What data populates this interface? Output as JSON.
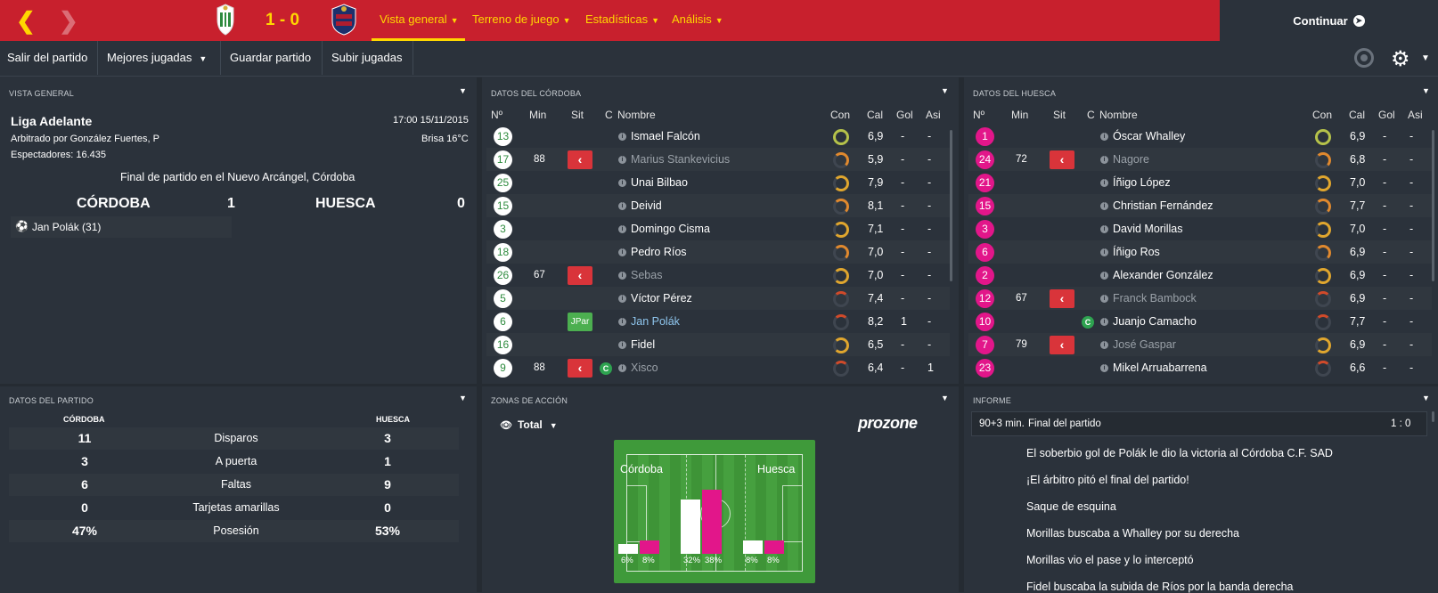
{
  "top": {
    "score": "1 - 0",
    "tabs": [
      {
        "label": "Vista general"
      },
      {
        "label": "Terreno de juego"
      },
      {
        "label": "Estadísticas"
      },
      {
        "label": "Análisis"
      }
    ],
    "continue_label": "Continuar"
  },
  "subbar": {
    "buttons": [
      "Salir del partido",
      "Mejores jugadas",
      "Guardar partido",
      "Subir jugadas"
    ]
  },
  "overview": {
    "title": "VISTA GENERAL",
    "league": "Liga Adelante",
    "datetime": "17:00 15/11/2015",
    "referee": "Arbitrado por González Fuertes, P",
    "weather": "Brisa 16°C",
    "attendance": "Espectadores: 16.435",
    "final": "Final de partido en el Nuevo Arcángel, Córdoba",
    "home": "CÓRDOBA",
    "home_goals": "1",
    "away": "HUESCA",
    "away_goals": "0",
    "scorer": "Jan Polák (31)"
  },
  "cordoba": {
    "title": "DATOS DEL CÓRDOBA",
    "headers": {
      "num": "Nº",
      "min": "Min",
      "sit": "Sit",
      "c": "C",
      "name": "Nombre",
      "con": "Con",
      "cal": "Cal",
      "gol": "Gol",
      "asi": "Asi"
    },
    "rows": [
      {
        "num": "13",
        "min": "",
        "name": "Ismael Falcón",
        "cal": "6,9",
        "gol": "-",
        "asi": "-"
      },
      {
        "num": "17",
        "min": "88",
        "name": "Marius Stankevicius",
        "cal": "5,9",
        "gol": "-",
        "asi": "-"
      },
      {
        "num": "25",
        "min": "",
        "name": "Unai Bilbao",
        "cal": "7,9",
        "gol": "-",
        "asi": "-"
      },
      {
        "num": "15",
        "min": "",
        "name": "Deivid",
        "cal": "8,1",
        "gol": "-",
        "asi": "-"
      },
      {
        "num": "3",
        "min": "",
        "name": "Domingo Cisma",
        "cal": "7,1",
        "gol": "-",
        "asi": "-"
      },
      {
        "num": "18",
        "min": "",
        "name": "Pedro Ríos",
        "cal": "7,0",
        "gol": "-",
        "asi": "-"
      },
      {
        "num": "26",
        "min": "67",
        "name": "Sebas",
        "cal": "7,0",
        "gol": "-",
        "asi": "-"
      },
      {
        "num": "5",
        "min": "",
        "name": "Víctor Pérez",
        "cal": "7,4",
        "gol": "-",
        "asi": "-"
      },
      {
        "num": "6",
        "min": "",
        "name": "Jan Polák",
        "cal": "8,2",
        "gol": "1",
        "asi": "-",
        "sit": "JPar"
      },
      {
        "num": "16",
        "min": "",
        "name": "Fidel",
        "cal": "6,5",
        "gol": "-",
        "asi": "-"
      },
      {
        "num": "9",
        "min": "88",
        "name": "Xisco",
        "cal": "6,4",
        "gol": "-",
        "asi": "1",
        "c": "C"
      }
    ]
  },
  "huesca": {
    "title": "DATOS DEL HUESCA",
    "rows": [
      {
        "num": "1",
        "min": "",
        "name": "Óscar Whalley",
        "cal": "6,9",
        "gol": "-",
        "asi": "-"
      },
      {
        "num": "24",
        "min": "72",
        "name": "Nagore",
        "cal": "6,8",
        "gol": "-",
        "asi": "-"
      },
      {
        "num": "21",
        "min": "",
        "name": "Íñigo López",
        "cal": "7,0",
        "gol": "-",
        "asi": "-"
      },
      {
        "num": "15",
        "min": "",
        "name": "Christian Fernández",
        "cal": "7,7",
        "gol": "-",
        "asi": "-"
      },
      {
        "num": "3",
        "min": "",
        "name": "David Morillas",
        "cal": "7,0",
        "gol": "-",
        "asi": "-"
      },
      {
        "num": "6",
        "min": "",
        "name": "Íñigo Ros",
        "cal": "6,9",
        "gol": "-",
        "asi": "-"
      },
      {
        "num": "2",
        "min": "",
        "name": "Alexander González",
        "cal": "6,9",
        "gol": "-",
        "asi": "-"
      },
      {
        "num": "12",
        "min": "67",
        "name": "Franck Bambock",
        "cal": "6,9",
        "gol": "-",
        "asi": "-"
      },
      {
        "num": "10",
        "min": "",
        "name": "Juanjo Camacho",
        "cal": "7,7",
        "gol": "-",
        "asi": "-",
        "c": "C"
      },
      {
        "num": "7",
        "min": "79",
        "name": "José Gaspar",
        "cal": "6,9",
        "gol": "-",
        "asi": "-"
      },
      {
        "num": "23",
        "min": "",
        "name": "Mikel Arruabarrena",
        "cal": "6,6",
        "gol": "-",
        "asi": "-"
      }
    ]
  },
  "match_stats": {
    "title": "DATOS DEL PARTIDO",
    "home": "CÓRDOBA",
    "away": "HUESCA",
    "rows": [
      {
        "home": "11",
        "label": "Disparos",
        "away": "3"
      },
      {
        "home": "3",
        "label": "A puerta",
        "away": "1"
      },
      {
        "home": "6",
        "label": "Faltas",
        "away": "9"
      },
      {
        "home": "0",
        "label": "Tarjetas amarillas",
        "away": "0"
      },
      {
        "home": "47%",
        "label": "Posesión",
        "away": "53%"
      }
    ]
  },
  "action_zones": {
    "title": "ZONAS DE ACCIÓN",
    "filter": "Total",
    "brand": "prozone",
    "home": "Córdoba",
    "away": "Huesca",
    "zones": [
      {
        "home": "6%",
        "away": "8%",
        "home_val": 6,
        "away_val": 8
      },
      {
        "home": "32%",
        "away": "38%",
        "home_val": 32,
        "away_val": 38
      },
      {
        "home": "8%",
        "away": "8%",
        "home_val": 8,
        "away_val": 8
      }
    ]
  },
  "report": {
    "title": "INFORME",
    "minute": "90+3 min.",
    "event": "Final del partido",
    "score": "1 : 0",
    "lines": [
      "El soberbio gol de Polák le dio la victoria al Córdoba C.F. SAD",
      "¡El árbitro pitó el final del partido!",
      "Saque de esquina",
      "Morillas buscaba a Whalley por su derecha",
      "Morillas vio el pase y lo interceptó",
      "Fidel buscaba la subida de Ríos por la banda derecha"
    ]
  },
  "colors": {
    "accent": "#c8202d",
    "yellow": "#ffd700",
    "home": "#ffffff",
    "away": "#e2168a"
  }
}
